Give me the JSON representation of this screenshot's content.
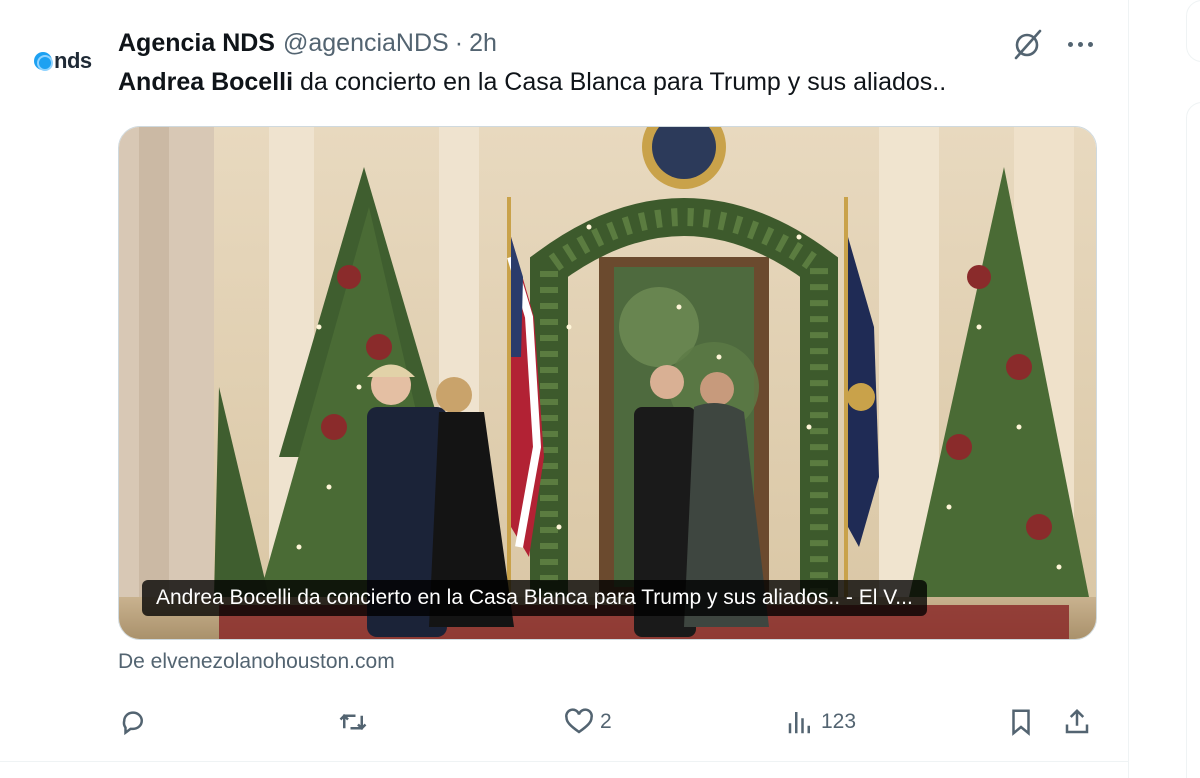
{
  "tweet": {
    "author_name": "Agencia NDS",
    "author_handle": "@agenciaNDS",
    "separator": "·",
    "time": "2h",
    "avatar_text": "nds",
    "text_bold": "Andrea Bocelli",
    "text_rest": " da concierto en la Casa Blanca para Trump y sus aliados..",
    "card_caption": "Andrea Bocelli da concierto en la Casa Blanca para Trump y sus aliados.. - El V...",
    "card_source": "De elvenezolanohouston.com",
    "stats": {
      "replies": "",
      "retweets": "",
      "likes": "2",
      "views": "123"
    }
  },
  "icons": {
    "avatar": "nds-logo-icon",
    "grok": "grok-icon",
    "more": "more-icon",
    "reply": "reply-icon",
    "retweet": "retweet-icon",
    "like": "heart-icon",
    "views": "views-icon",
    "bookmark": "bookmark-icon",
    "share": "share-icon"
  },
  "colors": {
    "text_primary": "#0f1419",
    "text_secondary": "#536471",
    "border": "#cfd9de",
    "brand_blue": "#1da1f2"
  }
}
